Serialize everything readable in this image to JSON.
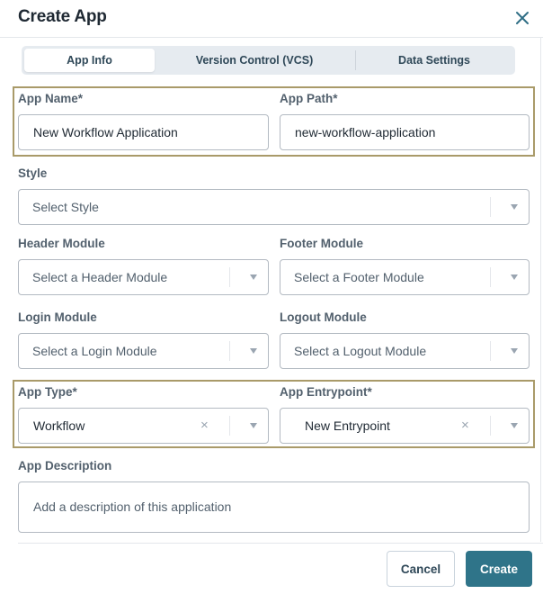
{
  "dialog": {
    "title": "Create App",
    "close_icon": "close-icon"
  },
  "tabs": [
    {
      "label": "App Info",
      "active": true
    },
    {
      "label": "Version Control (VCS)",
      "active": false
    },
    {
      "label": "Data Settings",
      "active": false
    }
  ],
  "form": {
    "app_name": {
      "label": "App Name*",
      "value": "New Workflow Application"
    },
    "app_path": {
      "label": "App Path*",
      "value": "new-workflow-application"
    },
    "style": {
      "label": "Style",
      "placeholder": "Select Style"
    },
    "header_module": {
      "label": "Header Module",
      "placeholder": "Select a Header Module"
    },
    "footer_module": {
      "label": "Footer Module",
      "placeholder": "Select a Footer Module"
    },
    "login_module": {
      "label": "Login Module",
      "placeholder": "Select a Login Module"
    },
    "logout_module": {
      "label": "Logout Module",
      "placeholder": "Select a Logout Module"
    },
    "app_type": {
      "label": "App Type*",
      "value": "Workflow"
    },
    "app_entrypoint": {
      "label": "App Entrypoint*",
      "value": "New Entrypoint"
    },
    "app_description": {
      "label": "App Description",
      "placeholder": "Add a description of this application"
    }
  },
  "footer": {
    "cancel_label": "Cancel",
    "create_label": "Create"
  },
  "colors": {
    "primary": "#2f7489",
    "highlight_border": "#a99a69",
    "tab_bg": "#e6ebf0"
  }
}
